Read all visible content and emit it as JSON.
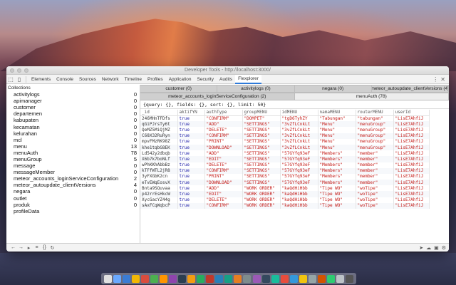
{
  "window": {
    "title": "Developer Tools - http://localhost:3000/"
  },
  "panel_tabs": [
    "Elements",
    "Console",
    "Sources",
    "Network",
    "Timeline",
    "Profiles",
    "Application",
    "Security",
    "Audits",
    "Flexplorer"
  ],
  "active_panel": "Flexplorer",
  "sidebar": {
    "header": "Collections",
    "collections": [
      {
        "name": "activitylogs",
        "count": "0"
      },
      {
        "name": "apimanager",
        "count": "0"
      },
      {
        "name": "customer",
        "count": "0"
      },
      {
        "name": "departemen",
        "count": "0"
      },
      {
        "name": "kabupaten",
        "count": "0"
      },
      {
        "name": "kecamatan",
        "count": "0"
      },
      {
        "name": "kelurahan",
        "count": "0"
      },
      {
        "name": "mcl",
        "count": "0"
      },
      {
        "name": "menu",
        "count": "13"
      },
      {
        "name": "menuAuth",
        "count": "78"
      },
      {
        "name": "menuGroup",
        "count": "5"
      },
      {
        "name": "message",
        "count": "0"
      },
      {
        "name": "messageMember",
        "count": "0"
      },
      {
        "name": "meteor_accounts_loginServiceConfiguration",
        "count": "2"
      },
      {
        "name": "meteor_autoupdate_clientVersions",
        "count": "4"
      },
      {
        "name": "negara",
        "count": "0"
      },
      {
        "name": "outlet",
        "count": "0"
      },
      {
        "name": "produk",
        "count": "0"
      },
      {
        "name": "profileData",
        "count": ""
      }
    ]
  },
  "collection_tabs_row1": [
    {
      "label": "customer (0)",
      "active": false
    },
    {
      "label": "activitylogs (0)",
      "active": false
    },
    {
      "label": "negara (0)",
      "active": false
    },
    {
      "label": "meteor_autoupdate_clientVersions (4)",
      "active": false
    }
  ],
  "collection_tabs_row2": [
    {
      "label": "meteor_accounts_loginServiceConfiguration (2)",
      "active": false
    },
    {
      "label": "menuAuth (78)",
      "active": true
    }
  ],
  "query": "{query: {}, fields: {}, sort: {}, limit: 50}",
  "table": {
    "columns": [
      "_id",
      "aktifYN",
      "authType",
      "groupMENU",
      "idMENU",
      "namaMENU",
      "routerMENU",
      "userId"
    ],
    "rows": [
      [
        "246MHnTFDfs",
        "true",
        "\"CONFIRM\"",
        "\"DOMPET\"",
        "\"tgD6TyhZY",
        "\"Tabungan\"",
        "\"tabungan\"",
        "\"LisE7AhfiJ"
      ],
      [
        "qGiPJrsTy6t",
        "true",
        "\"ADD\"",
        "\"SETTINGS\"",
        "\"3vZfLCnkLt",
        "\"Menu\"",
        "\"menuGroup\"",
        "\"LisE7AhfiJ"
      ],
      [
        "QeMZ5MiQjMZ",
        "true",
        "\"DELETE\"",
        "\"SETTINGS\"",
        "\"3vZfLCnkLt",
        "\"Menu\"",
        "\"menuGroup\"",
        "\"LisE7AhfiJ"
      ],
      [
        "C68X32RuRyn",
        "true",
        "\"CONFIRM\"",
        "\"SETTINGS\"",
        "\"3vZfLCnkLt",
        "\"Menu\"",
        "\"menuGroup\"",
        "\"LisE7AhfiJ"
      ],
      [
        "mpvFMzRK98Z",
        "true",
        "\"PRINT\"",
        "\"SETTINGS\"",
        "\"3vZfLCnkLt",
        "\"Menu\"",
        "\"menuGroup\"",
        "\"LisE7AhfiJ"
      ],
      [
        "khe1tqbG8EK",
        "true",
        "\"DOWNLOAD\"",
        "\"SETTINGS\"",
        "\"3vZfLCnkLt",
        "\"Menu\"",
        "\"menuGroup\"",
        "\"LisE7AhfiJ"
      ],
      [
        "Ld542y2dbqb",
        "true",
        "\"ADD\"",
        "\"SETTINGS\"",
        "\"57GYfq93eF",
        "\"Members\"",
        "\"member\"",
        "\"LisE7AhfiJ"
      ],
      [
        "X6b7k7boNLf",
        "true",
        "\"EDIT\"",
        "\"SETTINGS\"",
        "\"57GYfq93eF",
        "\"Members\"",
        "\"member\"",
        "\"LisE7AhfiJ"
      ],
      [
        "wPhKKhAbbBz",
        "true",
        "\"DELETE\"",
        "\"SETTINGS\"",
        "\"57GYfq93eF",
        "\"Members\"",
        "\"member\"",
        "\"LisE7AhfiJ"
      ],
      [
        "kTFfWTL2jR8",
        "true",
        "\"CONFIRM\"",
        "\"SETTINGS\"",
        "\"57GYfq93eF",
        "\"Members\"",
        "\"member\"",
        "\"LisE7AhfiJ"
      ],
      [
        "3yFXGbK2cn",
        "true",
        "\"PRINT\"",
        "\"SETTINGS\"",
        "\"57GYfq93eF",
        "\"Members\"",
        "\"member\"",
        "\"LisE7AhfiJ"
      ],
      [
        "eTvEWqEosvX",
        "true",
        "\"DOWNLOAD\"",
        "\"SETTINGS\"",
        "\"57GYfq93eF",
        "\"Members\"",
        "\"member\"",
        "\"LisE7AhfiJ"
      ],
      [
        "Bnta9SQuvaa",
        "true",
        "\"ADD\"",
        "\"WORK ORDER\"",
        "\"kaQdHiHbb",
        "\"Tipe WO\"",
        "\"woTipe\"",
        "\"LisE7AhfiJ"
      ],
      [
        "p42rrEsHkcW",
        "true",
        "\"EDIT\"",
        "\"WORK ORDER\"",
        "\"kaQdHiHbb",
        "\"Tipe WO\"",
        "\"woTipe\"",
        "\"LisE7AhfiJ"
      ],
      [
        "XycGacYZ44g",
        "true",
        "\"DELETE\"",
        "\"WORK ORDER\"",
        "\"kaQdHiHbb",
        "\"Tipe WO\"",
        "\"woTipe\"",
        "\"LisE7AhfiJ"
      ],
      [
        "sAxFCqWqbcP",
        "true",
        "\"CONFIRM\"",
        "\"WORK ORDER\"",
        "\"kaQdHiHbb",
        "\"Tipe WO\"",
        "\"woTipe\"",
        "\"LisE7AhfiJ"
      ]
    ]
  },
  "colors": {
    "string": "#c41a16",
    "boolean": "#1a1aa6",
    "accent": "#2e7ad9"
  },
  "dock_colors": [
    "#e0e0e0",
    "#6aa9ff",
    "#3b7cd4",
    "#f2b705",
    "#d94c3d",
    "#4caf50",
    "#ff9500",
    "#8e44ad",
    "#2c3e50",
    "#f39c12",
    "#27ae60",
    "#c0392b",
    "#2980b9",
    "#16a085",
    "#e67e22",
    "#7f8c8d",
    "#9b59b6",
    "#34495e",
    "#1abc9c",
    "#e74c3c",
    "#3498db",
    "#f1c40f",
    "#95a5a6",
    "#d35400",
    "#2ecc71",
    "#bdc3c7",
    "#555555"
  ]
}
